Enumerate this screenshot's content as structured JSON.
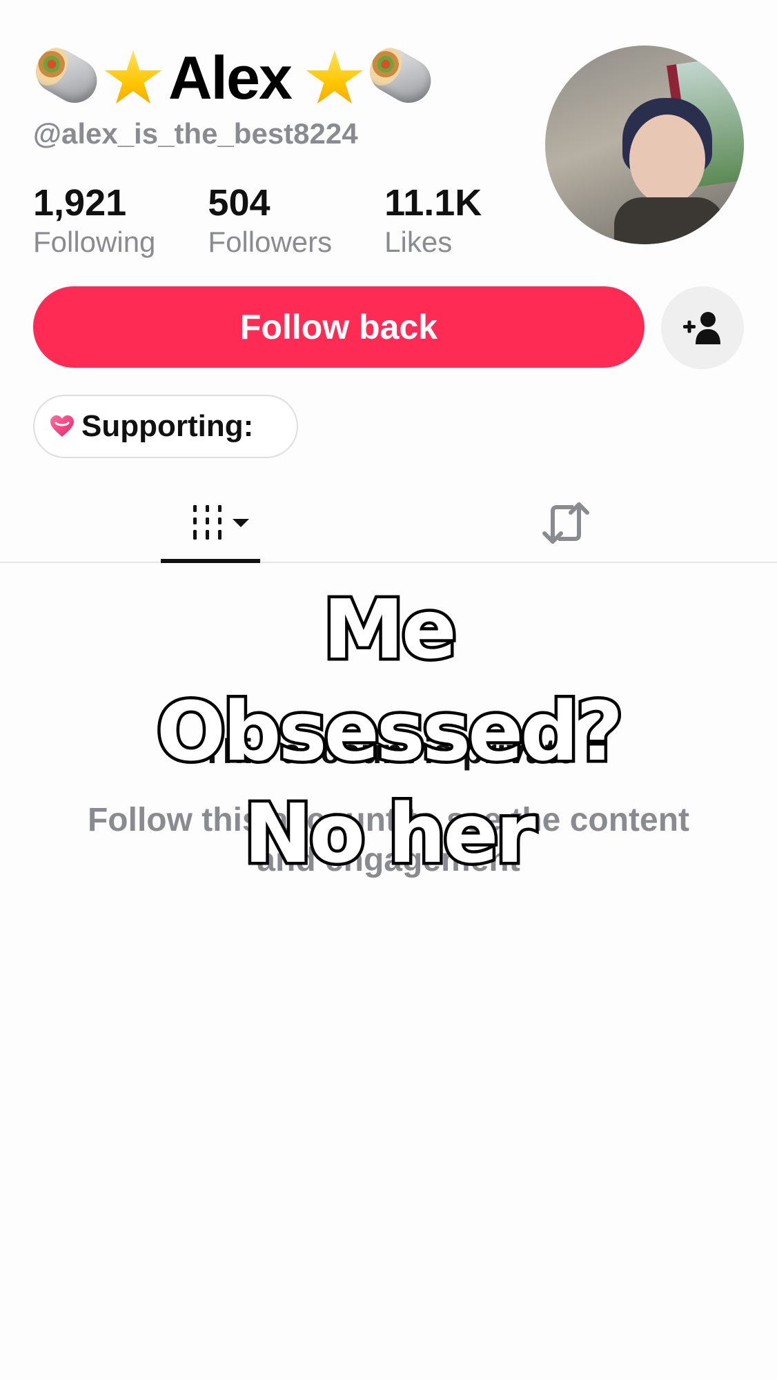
{
  "profile": {
    "display_name": "Alex",
    "username": "@alex_is_the_best8224",
    "name_emojis": [
      "burrito-icon",
      "star-icon",
      "star-icon",
      "burrito-icon"
    ]
  },
  "stats": [
    {
      "value": "1,921",
      "label": "Following"
    },
    {
      "value": "504",
      "label": "Followers"
    },
    {
      "value": "11.1K",
      "label": "Likes"
    }
  ],
  "actions": {
    "follow_back_label": "Follow back",
    "add_friend_icon": "add-user-icon"
  },
  "supporting": {
    "label": "Supporting:",
    "icon": "heart-icon"
  },
  "tabs": [
    {
      "name": "videos-grid-icon",
      "active": true
    },
    {
      "name": "repost-icon",
      "active": false
    }
  ],
  "private": {
    "title": "This account is private",
    "description": "Follow this account to see the content and engagement"
  },
  "overlay_caption": [
    "Me",
    "Obsessed?",
    "No her"
  ],
  "colors": {
    "accent": "#fe2c55",
    "muted_text": "#8a8b91",
    "background": "#fdfdfd"
  }
}
